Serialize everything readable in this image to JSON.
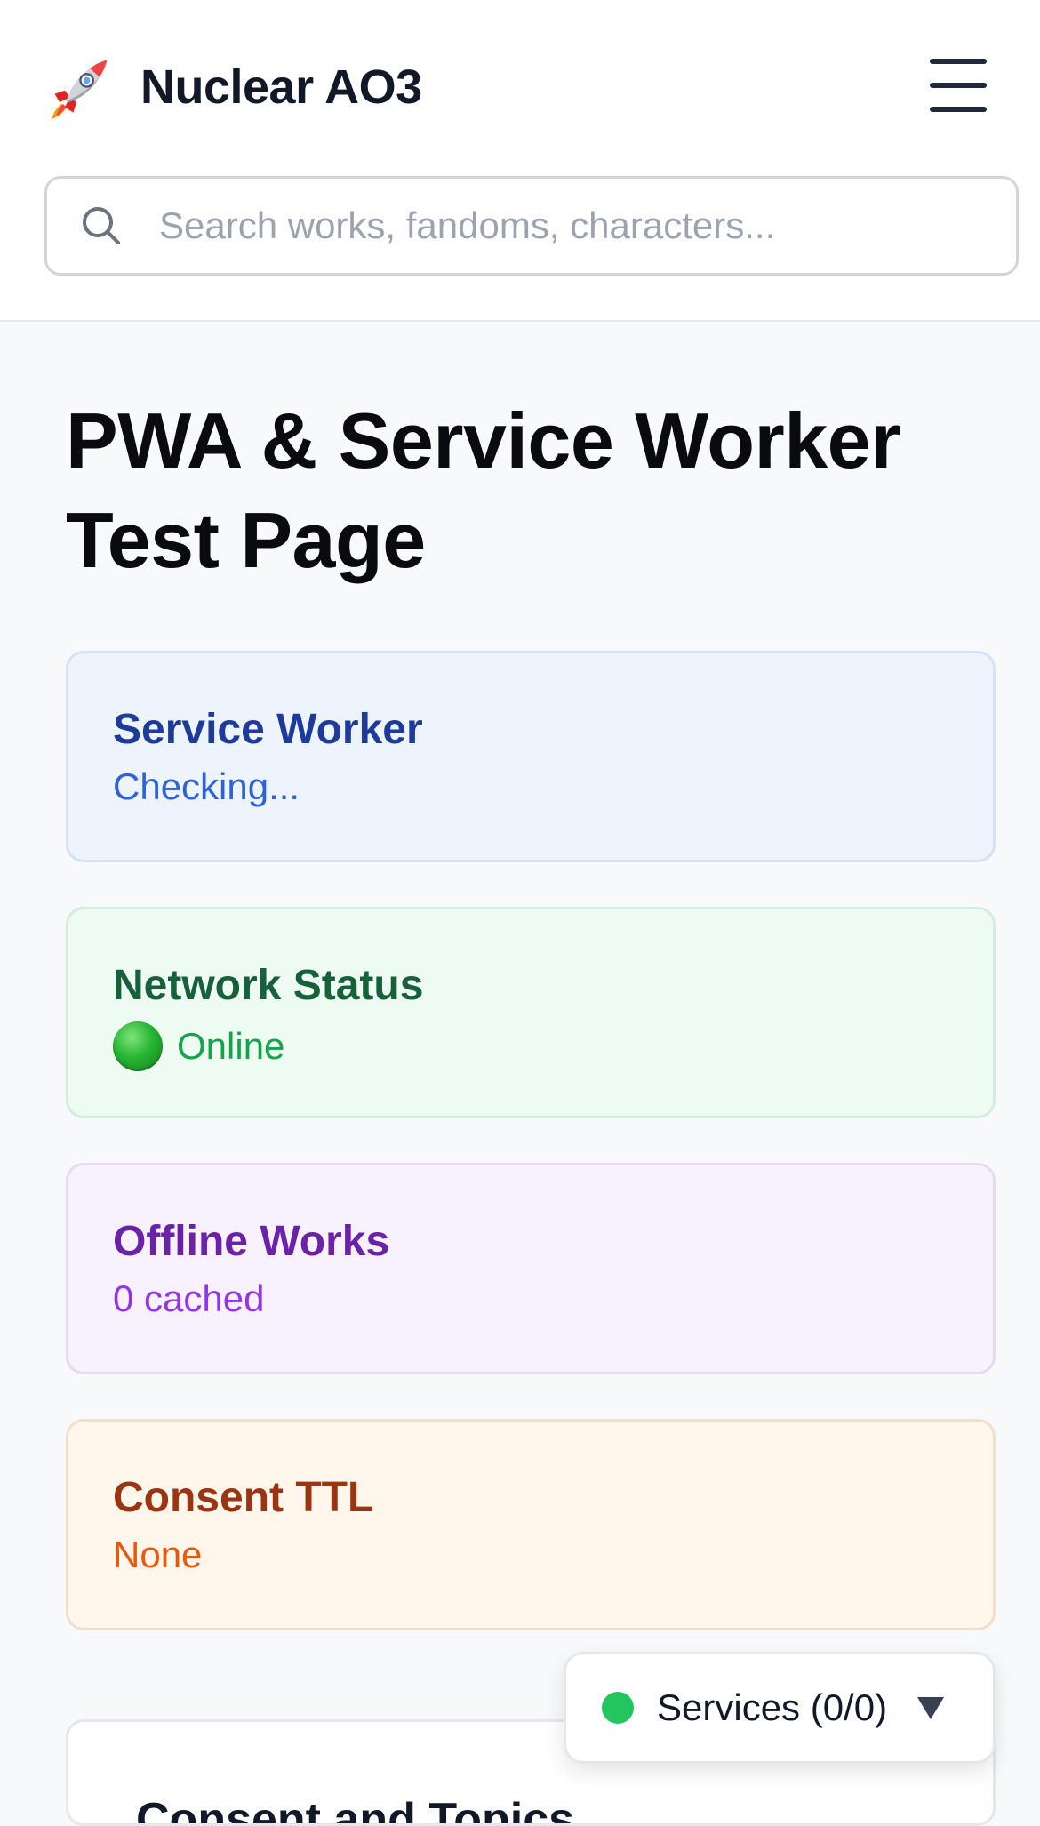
{
  "header": {
    "logo_icon": "rocket-icon",
    "app_title": "Nuclear AO3",
    "menu_icon": "hamburger-menu-icon"
  },
  "search": {
    "placeholder": "Search works, fandoms, characters...",
    "value": "",
    "icon": "search-icon"
  },
  "main": {
    "page_title": "PWA & Service Worker Test Page",
    "cards": [
      {
        "title": "Service Worker",
        "value": "Checking...",
        "accent": "#2f62d6"
      },
      {
        "title": "Network Status",
        "value": "Online",
        "status_icon": "green-circle-icon",
        "accent": "#16a34a"
      },
      {
        "title": "Offline Works",
        "value": "0 cached",
        "accent": "#9333ea"
      },
      {
        "title": "Consent TTL",
        "value": "None",
        "accent": "#ea580c"
      }
    ],
    "next_section_title": "Consent and Topics"
  },
  "services_widget": {
    "label": "Services (0/0)",
    "status_color": "#22c55e",
    "chevron_icon": "chevron-down-icon"
  }
}
